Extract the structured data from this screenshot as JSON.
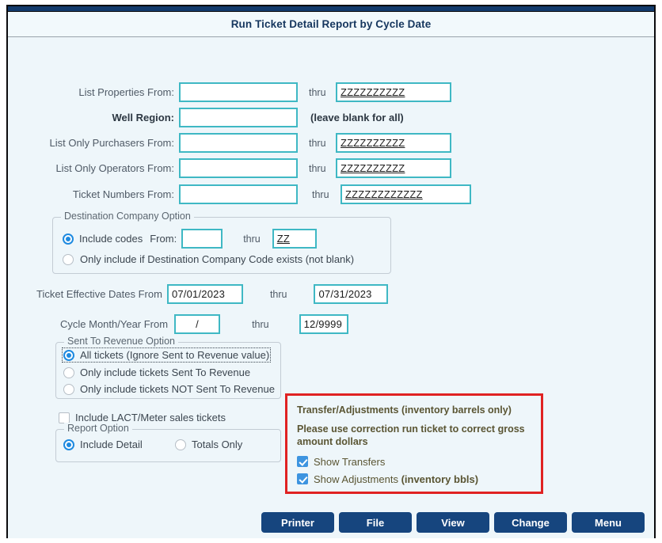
{
  "window": {
    "title": "Run Ticket Detail Report by Cycle Date"
  },
  "fields": {
    "properties": {
      "label": "List Properties From:",
      "from_value": "",
      "thru_label": "thru",
      "thru_value": "ZZZZZZZZZZ"
    },
    "well_region": {
      "label": "Well Region:",
      "value": "",
      "hint": "(leave blank for all)"
    },
    "purchasers": {
      "label": "List Only Purchasers From:",
      "from_value": "",
      "thru_label": "thru",
      "thru_value": "ZZZZZZZZZZ"
    },
    "operators": {
      "label": "List Only Operators From:",
      "from_value": "",
      "thru_label": "thru",
      "thru_value": "ZZZZZZZZZZ"
    },
    "ticket_numbers": {
      "label": "Ticket Numbers From:",
      "from_value": "",
      "thru_label": "thru",
      "thru_value": "ZZZZZZZZZZZZ"
    },
    "effective_dates": {
      "label": "Ticket Effective Dates From",
      "from_value": "07/01/2023",
      "thru_label": "thru",
      "thru_value": "07/31/2023"
    },
    "cycle_month_year": {
      "label": "Cycle Month/Year From",
      "from_value": "/",
      "thru_label": "thru",
      "thru_value": "12/9999"
    }
  },
  "destination_company_option": {
    "title": "Destination Company Option",
    "include_codes_label": "Include codes",
    "from_label": "From:",
    "from_value": "",
    "thru_label": "thru",
    "thru_value": "ZZ",
    "include_codes_selected": true,
    "only_if_exists_label": "Only include if Destination Company Code exists (not blank)",
    "only_if_exists_selected": false
  },
  "sent_to_revenue_option": {
    "title": "Sent To Revenue Option",
    "options": [
      {
        "label": "All tickets (Ignore Sent to Revenue value)",
        "selected": true,
        "focused": true
      },
      {
        "label": "Only include tickets Sent To Revenue",
        "selected": false,
        "focused": false
      },
      {
        "label": "Only include tickets NOT Sent To Revenue",
        "selected": false,
        "focused": false
      }
    ]
  },
  "lact_checkbox": {
    "label": "Include LACT/Meter sales tickets",
    "checked": false
  },
  "report_option": {
    "title": "Report Option",
    "options": [
      {
        "label": "Include Detail",
        "selected": true
      },
      {
        "label": "Totals Only",
        "selected": false
      }
    ]
  },
  "transfer_adjustments": {
    "heading": "Transfer/Adjustments (inventory barrels only)",
    "note": "Please use correction run ticket to correct gross amount dollars",
    "show_transfers": {
      "label": "Show Transfers",
      "checked": true
    },
    "show_adjustments": {
      "label_plain": "Show Adjustments ",
      "label_bold": "(inventory bbls)",
      "checked": true
    },
    "border_color": "#e02222"
  },
  "buttons": [
    {
      "label": "Printer"
    },
    {
      "label": "File"
    },
    {
      "label": "View"
    },
    {
      "label": "Change"
    },
    {
      "label": "Menu"
    }
  ],
  "colors": {
    "field_border": "#3fb8c4",
    "accent_blue": "#1e8ae0",
    "button_bg": "#16457e",
    "panel_bg": "#eef6fa"
  }
}
